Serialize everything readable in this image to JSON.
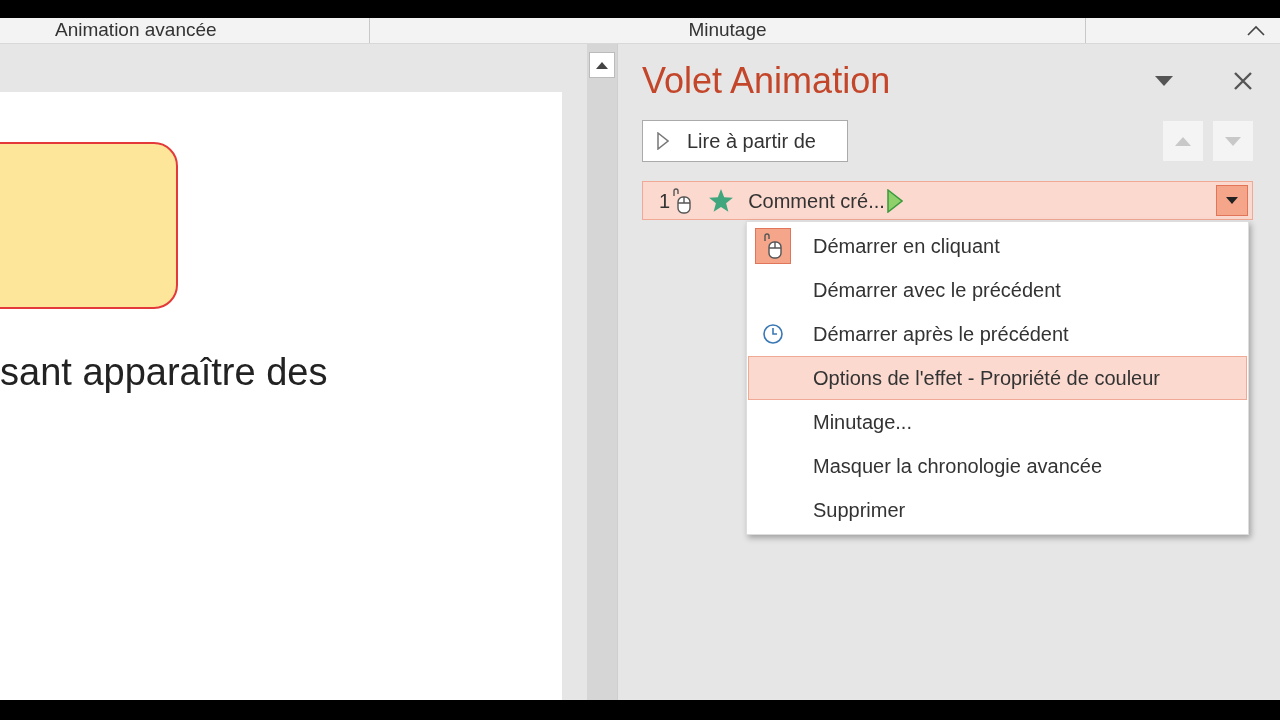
{
  "ribbon_groups": [
    "Animation avancée",
    "Minutage"
  ],
  "slide": {
    "text": "sant apparaître des"
  },
  "pane": {
    "title": "Volet Animation",
    "play_button": "Lire à partir de",
    "animation_item": {
      "number": "1",
      "name": "Comment cré...",
      "selected": true
    },
    "menu": [
      {
        "label": "Démarrer en cliquant",
        "kind": "mouse",
        "checked": true,
        "selected": false
      },
      {
        "label": "Démarrer avec le précédent",
        "kind": "plain",
        "checked": false,
        "selected": false
      },
      {
        "label": "Démarrer après le précédent",
        "kind": "clock",
        "checked": false,
        "selected": false
      },
      {
        "label": "Options de l'effet - Propriété de couleur",
        "kind": "plain",
        "checked": false,
        "selected": true
      },
      {
        "label": "Minutage...",
        "kind": "plain",
        "checked": false,
        "selected": false
      },
      {
        "label": "Masquer la chronologie avancée",
        "kind": "plain",
        "checked": false,
        "selected": false
      },
      {
        "label": "Supprimer",
        "kind": "plain",
        "checked": false,
        "selected": false
      }
    ]
  }
}
